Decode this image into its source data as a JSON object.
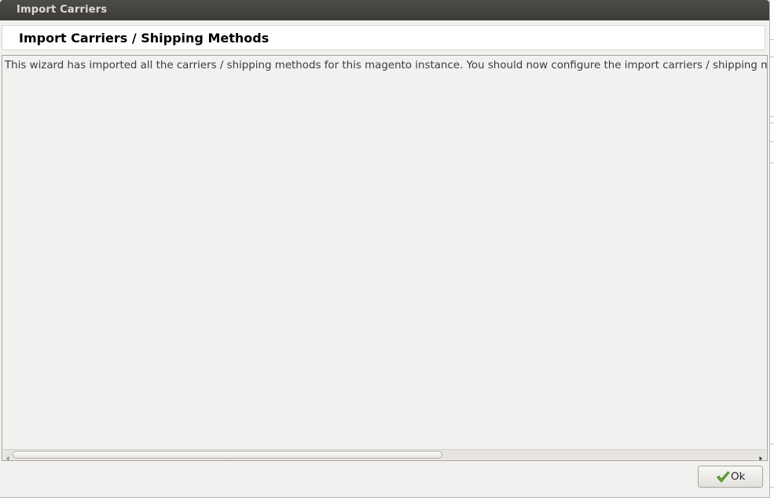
{
  "window": {
    "title": "Import Carriers"
  },
  "header": {
    "heading": "Import Carriers / Shipping Methods"
  },
  "content": {
    "message": "This wizard has imported all the carriers / shipping methods for this magento instance. You should now configure the import carriers / shipping methods."
  },
  "footer": {
    "ok_label": "Ok"
  },
  "icons": {
    "ok_button_icon": "check-icon",
    "scroll_left_icon": "arrow-left-icon",
    "scroll_right_icon": "arrow-right-icon"
  },
  "colors": {
    "titlebar": "#3c3b37",
    "title_text": "#dfdbd2",
    "dialog_background": "#f2f1f0",
    "check_green": "#5c9a2e"
  }
}
